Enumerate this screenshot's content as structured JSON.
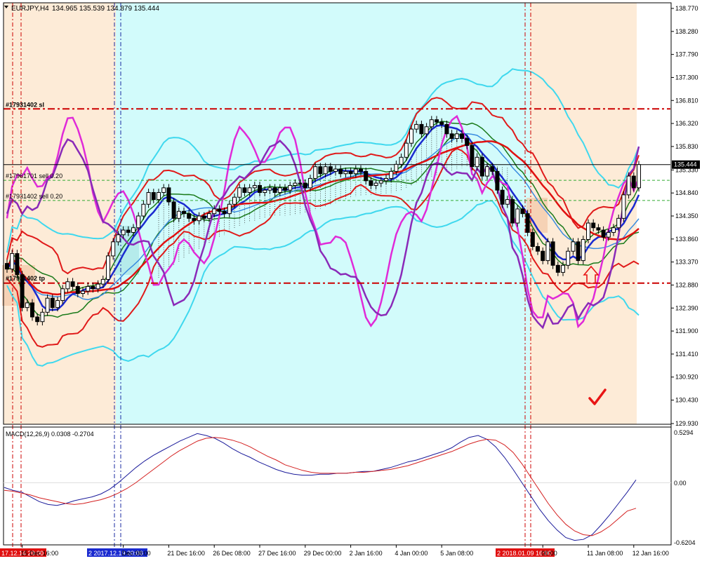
{
  "header": {
    "symbol_tf": "EURJPY,H4",
    "ohlc": "134.965 135.539 134.879 135.444"
  },
  "price_axis": {
    "labels": [
      "138.770",
      "138.280",
      "137.790",
      "137.300",
      "136.810",
      "136.320",
      "135.830",
      "135.330",
      "134.840",
      "134.350",
      "133.860",
      "133.370",
      "132.880",
      "132.390",
      "131.900",
      "131.410",
      "130.920",
      "130.430",
      "129.930"
    ],
    "current_price": "135.444",
    "current_price_value": 135.444
  },
  "orders": {
    "sl_label": "#17931402 sl",
    "sl_price": 136.63,
    "tp_label": "#17931402 tp",
    "tp_price": 132.92,
    "sell1_label": "#17961701 sell 0.20",
    "sell1_price": 135.11,
    "sell2_label": "#17931402 sell 0.20",
    "sell2_price": 134.68
  },
  "macd": {
    "title": "MACD(12,26,9) 0.0308 -0.2704",
    "axis_labels": [
      "0.5294",
      "0.00",
      "-0.6204"
    ],
    "max": 0.5294,
    "min": -0.6204
  },
  "time_axis": {
    "labels": [
      {
        "text": "15 Dec 16:00",
        "i": 3
      },
      {
        "text": "Dec 08:00",
        "i": 23
      },
      {
        "text": "21 Dec 16:00",
        "i": 32
      },
      {
        "text": "26 Dec 08:00",
        "i": 41
      },
      {
        "text": "27 Dec 16:00",
        "i": 50
      },
      {
        "text": "29 Dec 00:00",
        "i": 59
      },
      {
        "text": "2 Jan 16:00",
        "i": 68
      },
      {
        "text": "4 Jan 00:00",
        "i": 77
      },
      {
        "text": "5 Jan 08:00",
        "i": 86
      },
      {
        "text": "00:00",
        "i": 106
      },
      {
        "text": "11 Jan 08:00",
        "i": 115
      },
      {
        "text": "12 Jan 16:00",
        "i": 124
      }
    ],
    "highlight_red_1": "17.12.14 20:00",
    "highlight_blue": "2 2017.12.19 20:00",
    "highlight_red_2": "2 2018.01.09 16:00"
  },
  "colors": {
    "bg_peach": "#fdebd7",
    "bg_cyan": "#d2fbfb",
    "bull_candle": "#ffffff",
    "bear_candle": "#000000",
    "order_line": "#cc0000"
  },
  "chart_data": {
    "type": "candlestick",
    "price_range": [
      129.93,
      138.77
    ],
    "candles_close": [
      133.22,
      133.55,
      133.1,
      132.4,
      132.5,
      132.2,
      132.1,
      132.3,
      132.6,
      132.4,
      132.55,
      132.8,
      132.95,
      132.85,
      132.7,
      132.75,
      132.85,
      132.8,
      132.9,
      133.0,
      133.5,
      133.8,
      133.95,
      134.05,
      134.0,
      134.1,
      134.35,
      134.6,
      134.85,
      134.7,
      134.85,
      134.95,
      134.65,
      134.3,
      134.45,
      134.4,
      134.3,
      134.25,
      134.35,
      134.3,
      134.4,
      134.5,
      134.45,
      134.4,
      134.6,
      134.75,
      134.95,
      134.85,
      134.95,
      135.0,
      134.85,
      134.9,
      134.95,
      134.85,
      134.95,
      134.9,
      135.0,
      135.05,
      135.05,
      134.95,
      135.15,
      135.4,
      135.25,
      135.4,
      135.3,
      135.35,
      135.25,
      135.3,
      135.25,
      135.35,
      135.3,
      135.1,
      135.0,
      135.05,
      135.1,
      135.15,
      135.3,
      135.45,
      135.6,
      135.9,
      136.2,
      136.3,
      136.1,
      136.25,
      136.4,
      136.35,
      136.3,
      136.1,
      136.0,
      136.1,
      136.0,
      135.85,
      135.4,
      135.6,
      135.2,
      135.4,
      135.3,
      134.9,
      134.6,
      134.7,
      134.2,
      134.5,
      134.4,
      134.0,
      133.7,
      133.6,
      133.4,
      133.8,
      133.3,
      133.15,
      133.3,
      133.6,
      133.8,
      133.4,
      133.85,
      134.2,
      134.1,
      134.05,
      133.9,
      134.0,
      134.1,
      134.3,
      134.8,
      135.2,
      134.95,
      135.444
    ],
    "macd_main": [
      -0.05,
      -0.08,
      -0.1,
      -0.15,
      -0.2,
      -0.23,
      -0.24,
      -0.22,
      -0.19,
      -0.17,
      -0.15,
      -0.12,
      -0.07,
      0.0,
      0.08,
      0.16,
      0.23,
      0.29,
      0.34,
      0.39,
      0.44,
      0.48,
      0.52,
      0.5,
      0.47,
      0.42,
      0.36,
      0.31,
      0.27,
      0.22,
      0.18,
      0.14,
      0.11,
      0.09,
      0.08,
      0.08,
      0.09,
      0.09,
      0.1,
      0.1,
      0.11,
      0.12,
      0.12,
      0.14,
      0.16,
      0.19,
      0.22,
      0.24,
      0.27,
      0.3,
      0.33,
      0.37,
      0.43,
      0.48,
      0.5,
      0.46,
      0.38,
      0.27,
      0.14,
      0.0,
      -0.14,
      -0.28,
      -0.4,
      -0.5,
      -0.58,
      -0.61,
      -0.6,
      -0.55,
      -0.45,
      -0.34,
      -0.22,
      -0.1,
      0.03
    ],
    "macd_signal": [
      -0.08,
      -0.09,
      -0.11,
      -0.13,
      -0.16,
      -0.18,
      -0.2,
      -0.22,
      -0.23,
      -0.22,
      -0.2,
      -0.18,
      -0.15,
      -0.11,
      -0.06,
      0.0,
      0.07,
      0.14,
      0.21,
      0.28,
      0.34,
      0.39,
      0.44,
      0.47,
      0.48,
      0.47,
      0.45,
      0.42,
      0.38,
      0.33,
      0.28,
      0.24,
      0.19,
      0.16,
      0.13,
      0.11,
      0.1,
      0.1,
      0.1,
      0.1,
      0.11,
      0.11,
      0.12,
      0.13,
      0.14,
      0.16,
      0.18,
      0.21,
      0.24,
      0.27,
      0.3,
      0.33,
      0.37,
      0.41,
      0.44,
      0.46,
      0.45,
      0.4,
      0.32,
      0.2,
      0.06,
      -0.08,
      -0.22,
      -0.34,
      -0.44,
      -0.51,
      -0.55,
      -0.56,
      -0.52,
      -0.46,
      -0.38,
      -0.3,
      -0.27
    ]
  }
}
